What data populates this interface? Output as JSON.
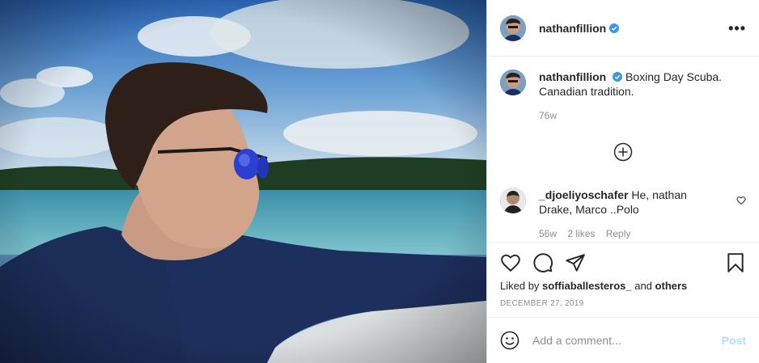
{
  "post": {
    "username": "nathanfillion",
    "more_label": "•••"
  },
  "caption": {
    "username": "nathanfillion",
    "text": "Boxing Day Scuba. Canadian tradition.",
    "time": "76w"
  },
  "comment": {
    "username": "_djoeliyoschafer",
    "text": "He, nathan Drake, Marco ..Polo",
    "meta_time": "56w",
    "meta_likes": "2 likes",
    "meta_reply": "Reply"
  },
  "likes": {
    "prefix": "Liked by",
    "user": "soffiaballesteros_",
    "mid": "and",
    "others": "others"
  },
  "date": "DECEMBER 27, 2019",
  "add_comment": {
    "placeholder": "Add a comment...",
    "post_label": "Post"
  },
  "colors": {
    "verified": "#3897f0",
    "post_disabled": "#b2dffc",
    "secondary_text": "#8e8e8e"
  },
  "icons": [
    "more-icon",
    "verified-icon",
    "load-more-icon",
    "heart-icon",
    "comment-icon",
    "share-icon",
    "bookmark-icon",
    "emoji-icon"
  ]
}
